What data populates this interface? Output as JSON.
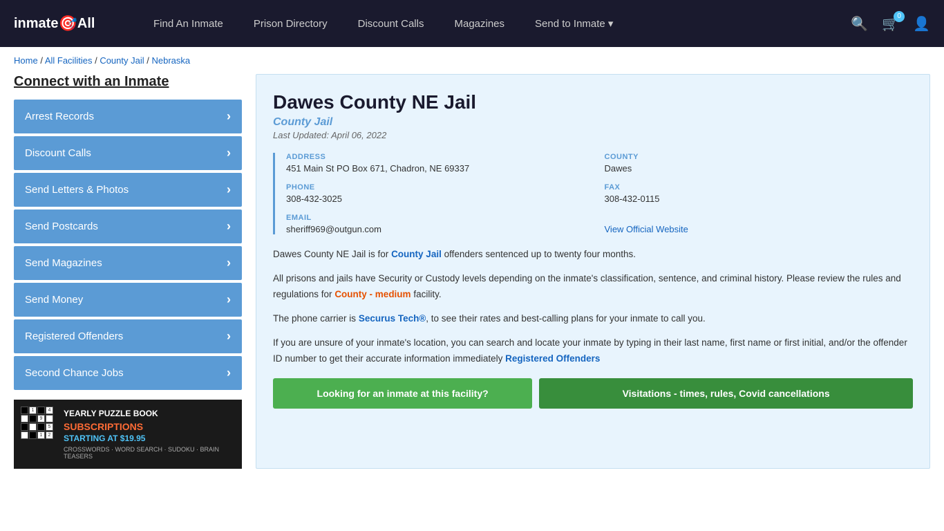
{
  "header": {
    "logo": "inmateAll",
    "logo_icon": "🎯",
    "nav_items": [
      {
        "label": "Find An Inmate",
        "id": "find-an-inmate"
      },
      {
        "label": "Prison Directory",
        "id": "prison-directory"
      },
      {
        "label": "Discount Calls",
        "id": "discount-calls"
      },
      {
        "label": "Magazines",
        "id": "magazines"
      },
      {
        "label": "Send to Inmate ▾",
        "id": "send-to-inmate"
      }
    ],
    "cart_count": "0",
    "search_icon": "🔍",
    "cart_icon": "🛒",
    "user_icon": "👤"
  },
  "breadcrumb": {
    "home": "Home",
    "all_facilities": "All Facilities",
    "county_jail": "County Jail",
    "state": "Nebraska"
  },
  "sidebar": {
    "title": "Connect with an Inmate",
    "items": [
      {
        "label": "Arrest Records",
        "id": "arrest-records"
      },
      {
        "label": "Discount Calls",
        "id": "discount-calls-side"
      },
      {
        "label": "Send Letters & Photos",
        "id": "send-letters"
      },
      {
        "label": "Send Postcards",
        "id": "send-postcards"
      },
      {
        "label": "Send Magazines",
        "id": "send-magazines"
      },
      {
        "label": "Send Money",
        "id": "send-money"
      },
      {
        "label": "Registered Offenders",
        "id": "registered-offenders"
      },
      {
        "label": "Second Chance Jobs",
        "id": "second-chance-jobs"
      }
    ],
    "ad": {
      "title": "YEARLY PUZZLE BOOK",
      "subtitle": "SUBSCRIPTIONS",
      "price": "STARTING AT $19.95",
      "types": "CROSSWORDS · WORD SEARCH · SUDOKU · BRAIN TEASERS"
    }
  },
  "facility": {
    "title": "Dawes County NE Jail",
    "subtitle": "County Jail",
    "last_updated": "Last Updated: April 06, 2022",
    "address_label": "ADDRESS",
    "address_value": "451 Main St PO Box 671, Chadron, NE 69337",
    "county_label": "COUNTY",
    "county_value": "Dawes",
    "phone_label": "PHONE",
    "phone_value": "308-432-3025",
    "fax_label": "FAX",
    "fax_value": "308-432-0115",
    "email_label": "EMAIL",
    "email_value": "sheriff969@outgun.com",
    "official_website_label": "View Official Website",
    "description": [
      "Dawes County NE Jail is for County Jail offenders sentenced up to twenty four months.",
      "All prisons and jails have Security or Custody levels depending on the inmate's classification, sentence, and criminal history. Please review the rules and regulations for County - medium facility.",
      "The phone carrier is Securus Tech®, to see their rates and best-calling plans for your inmate to call you.",
      "If you are unsure of your inmate's location, you can search and locate your inmate by typing in their last name, first name or first initial, and/or the offender ID number to get their accurate information immediately Registered Offenders"
    ],
    "county_jail_link": "County Jail",
    "county_medium_link": "County - medium",
    "securus_link": "Securus Tech®",
    "registered_link": "Registered Offenders",
    "btn_looking": "Looking for an inmate at this facility?",
    "btn_visitation": "Visitations - times, rules, Covid cancellations"
  }
}
